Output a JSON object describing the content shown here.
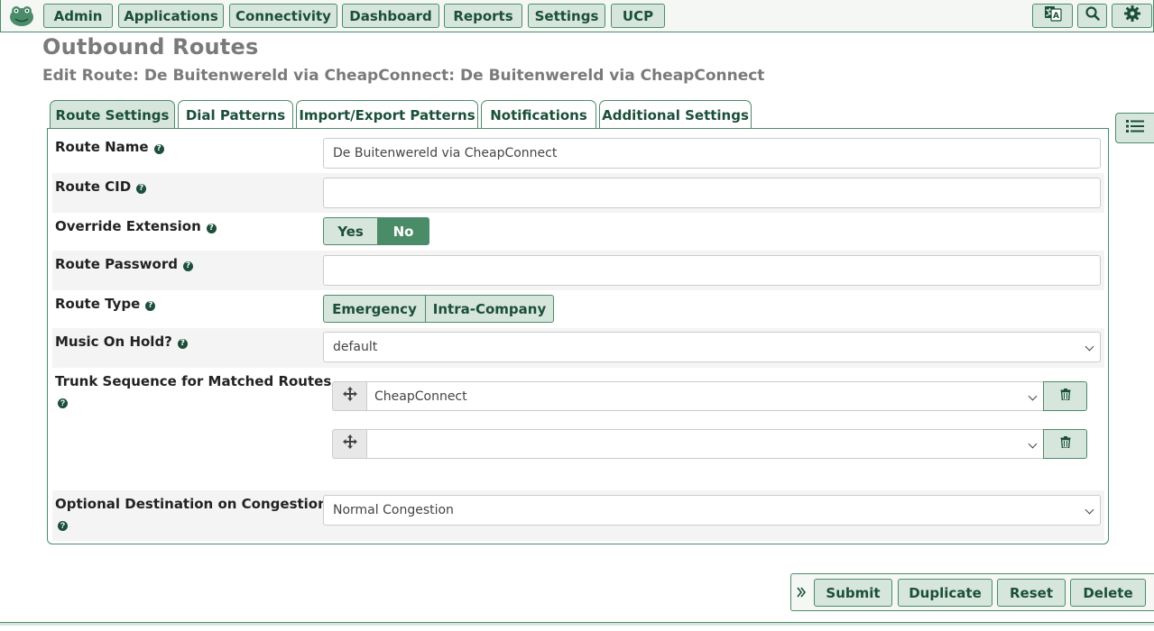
{
  "nav": {
    "items": [
      "Admin",
      "Applications",
      "Connectivity",
      "Dashboard",
      "Reports",
      "Settings",
      "UCP"
    ],
    "icons": [
      "translate-icon",
      "search-icon",
      "gear-icon"
    ]
  },
  "page": {
    "title": "Outbound Routes",
    "subtitle": "Edit Route: De Buitenwereld via CheapConnect: De Buitenwereld via CheapConnect"
  },
  "tabs": [
    "Route Settings",
    "Dial Patterns",
    "Import/Export Patterns",
    "Notifications",
    "Additional Settings"
  ],
  "active_tab": "Route Settings",
  "form": {
    "route_name": {
      "label": "Route Name",
      "value": "De Buitenwereld via CheapConnect"
    },
    "route_cid": {
      "label": "Route CID",
      "value": ""
    },
    "override_extension": {
      "label": "Override Extension",
      "yes": "Yes",
      "no": "No",
      "selected": "No"
    },
    "route_password": {
      "label": "Route Password",
      "value": ""
    },
    "route_type": {
      "label": "Route Type",
      "emergency": "Emergency",
      "intra": "Intra-Company"
    },
    "music_on_hold": {
      "label": "Music On Hold?",
      "value": "default"
    },
    "trunk_sequence": {
      "label": "Trunk Sequence for Matched Routes",
      "trunks": [
        "CheapConnect",
        ""
      ]
    },
    "congestion": {
      "label": "Optional Destination on Congestion",
      "value": "Normal Congestion"
    }
  },
  "actions": {
    "submit": "Submit",
    "duplicate": "Duplicate",
    "reset": "Reset",
    "delete": "Delete"
  },
  "colors": {
    "accent": "#4c8b6a",
    "button_bg": "#d7e6dc",
    "button_text": "#1b4f3a",
    "active_toggle": "#4a8c68"
  }
}
